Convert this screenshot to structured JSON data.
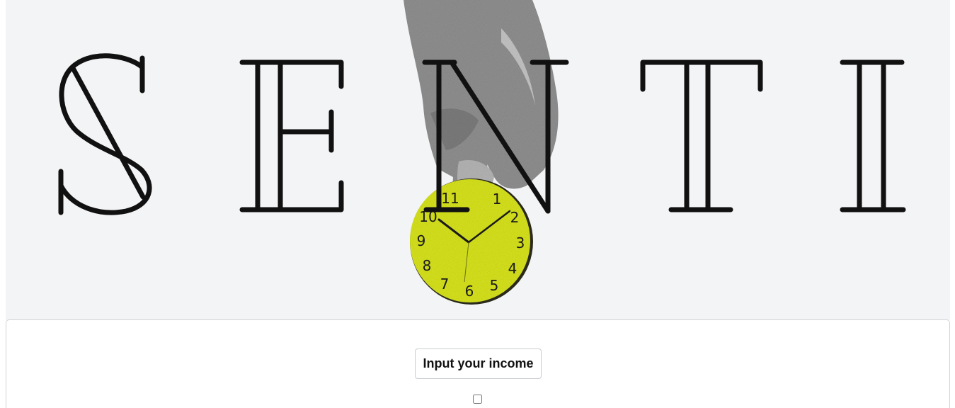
{
  "hero": {
    "title_letters": [
      "S",
      "E",
      "N",
      "T",
      "I"
    ],
    "clock_numerals": [
      "1",
      "2",
      "3",
      "4",
      "5",
      "6",
      "7",
      "8",
      "9",
      "10",
      "11"
    ],
    "clock_face_color": "#d6e21b",
    "letter_color": "#111111",
    "background_color": "#f3f4f6"
  },
  "form": {
    "income_button_label": "Input your income",
    "checkbox_checked": false
  }
}
